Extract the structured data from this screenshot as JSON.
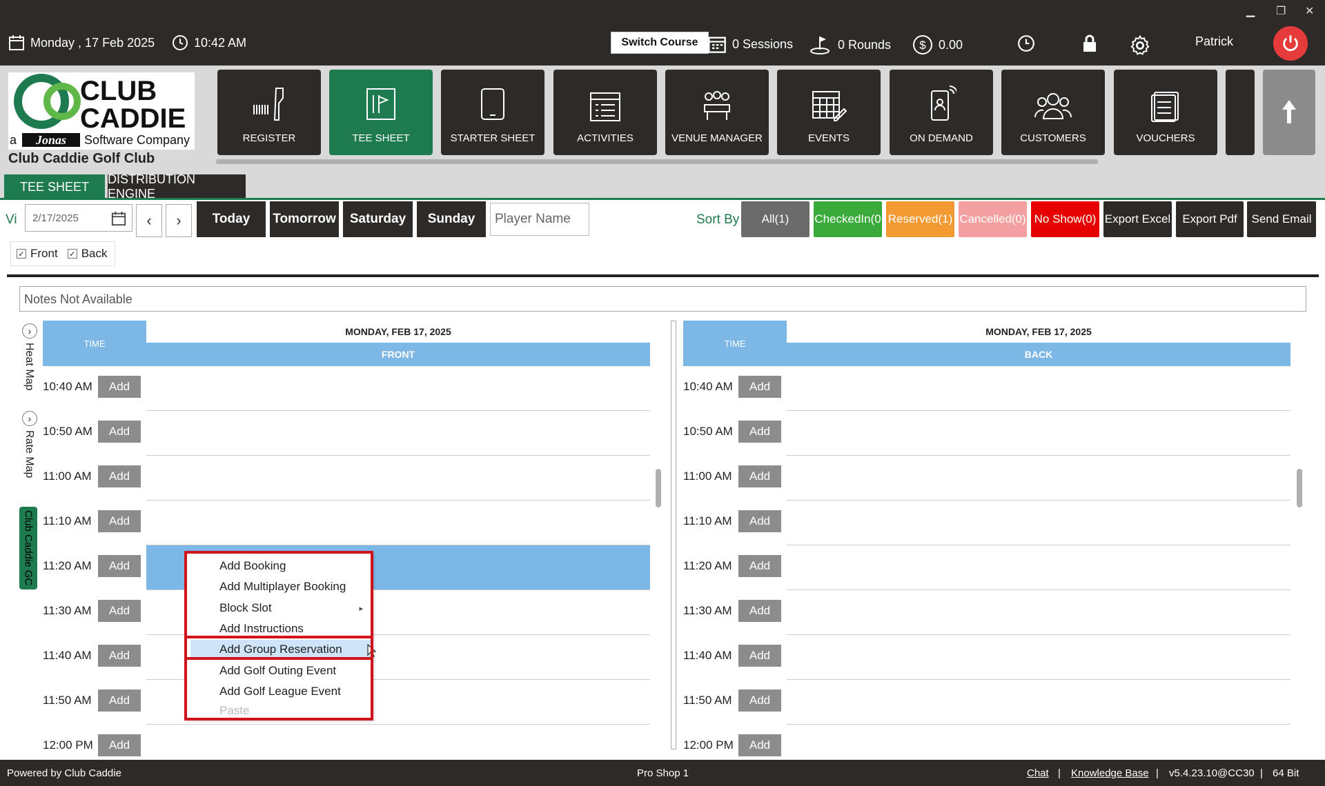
{
  "topbar": {
    "date": "Monday ,  17 Feb 2025",
    "time": "10:42 AM",
    "switch_course": "Switch Course",
    "sessions": "0 Sessions",
    "rounds": "0 Rounds",
    "balance": "0.00",
    "user": "Patrick",
    "minimize": "▁",
    "restore": "❐",
    "close": "✕"
  },
  "logo": {
    "line1": "CLUB",
    "line2": "CADDIE",
    "tagline_a": "a",
    "tagline_jonas": "Jonas",
    "tagline_rest": "Software Company"
  },
  "club_name": "Club Caddie Golf Club",
  "nav": {
    "tiles": [
      "REGISTER",
      "TEE SHEET",
      "STARTER SHEET",
      "ACTIVITIES",
      "VENUE MANAGER",
      "EVENTS",
      "ON DEMAND",
      "CUSTOMERS",
      "VOUCHERS"
    ]
  },
  "tabs": {
    "tee_sheet": "TEE SHEET",
    "distribution": "DISTRIBUTION ENGINE"
  },
  "toolbar": {
    "view_label": "Vi",
    "date_value": "2/17/2025",
    "prev": "‹",
    "next": "›",
    "today": "Today",
    "tomorrow": "Tomorrow",
    "saturday": "Saturday",
    "sunday": "Sunday",
    "player_placeholder": "Player Name",
    "sort_by": "Sort By",
    "all": "All(1)",
    "checkedin": "CheckedIn(0",
    "reserved": "Reserved(1)",
    "cancelled": "Cancelled(0)",
    "noshow": "No Show(0)",
    "export_excel": "Export Excel",
    "export_pdf": "Export Pdf",
    "send_email": "Send Email",
    "front": "Front",
    "back": "Back",
    "check_mark": "✓"
  },
  "notes": "Notes Not Available",
  "sidebar": {
    "heat_map": "Heat Map",
    "rate_map": "Rate Map",
    "gc_tab": "Club Caddie GC"
  },
  "sheets": {
    "time_header": "TIME",
    "date_header": "MONDAY, FEB 17, 2025",
    "front_header": "FRONT",
    "back_header": "BACK",
    "add_label": "Add",
    "times": [
      "10:40 AM",
      "10:50 AM",
      "11:00 AM",
      "11:10 AM",
      "11:20 AM",
      "11:30 AM",
      "11:40 AM",
      "11:50 AM",
      "12:00 PM"
    ]
  },
  "context_menu": {
    "items": [
      "Add Booking",
      "Add Multiplayer Booking",
      "Block Slot",
      "Add Instructions",
      "Add Group Reservation",
      "Add Golf Outing Event",
      "Add Golf League Event",
      "Paste"
    ],
    "submenu_arrow": "▸"
  },
  "statusbar": {
    "powered": "Powered by Club Caddie",
    "terminal": "Pro Shop 1",
    "chat": "Chat",
    "sep": "|",
    "kb": "Knowledge Base",
    "version": "v5.4.23.10@CC30",
    "bits": "64 Bit"
  },
  "colors": {
    "brand_green": "#1e7a4f",
    "dark": "#2e2a27",
    "header_blue": "#7db7e5",
    "power_red": "#e63b3b",
    "highlight_red": "#d0121b"
  }
}
